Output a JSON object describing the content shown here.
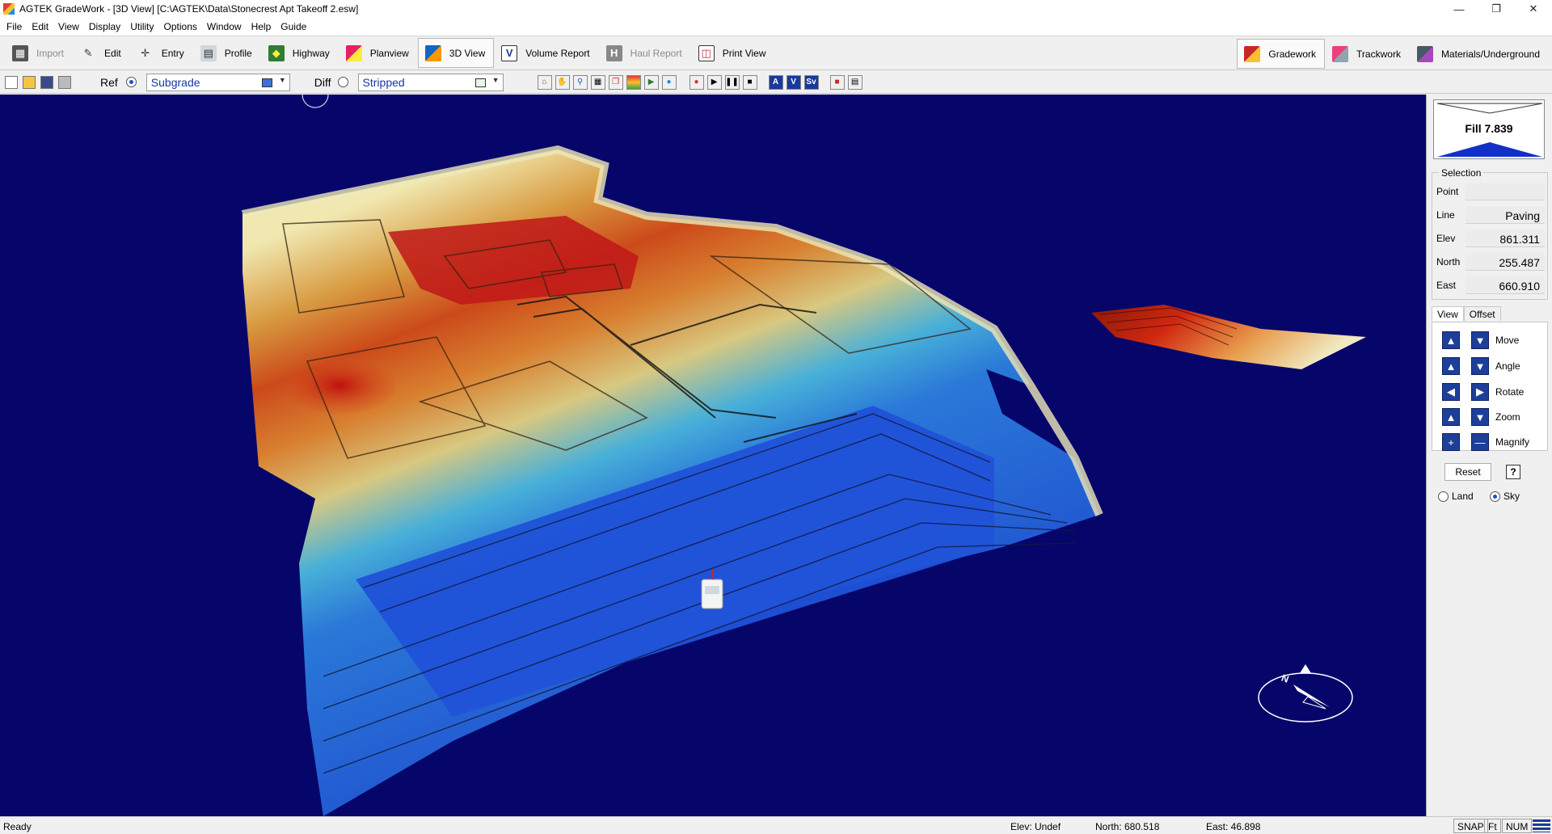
{
  "window": {
    "title": "AGTEK GradeWork - [3D View]  [C:\\AGTEK\\Data\\Stonecrest Apt Takeoff 2.esw]"
  },
  "menu": [
    "File",
    "Edit",
    "View",
    "Display",
    "Utility",
    "Options",
    "Window",
    "Help",
    "Guide"
  ],
  "main_toolbar": {
    "import": "Import",
    "edit": "Edit",
    "entry": "Entry",
    "profile": "Profile",
    "highway": "Highway",
    "planview": "Planview",
    "view3d": "3D View",
    "volume_report": "Volume Report",
    "haul_report": "Haul Report",
    "print_view": "Print View"
  },
  "modes": {
    "gradework": "Gradework",
    "trackwork": "Trackwork",
    "materials": "Materials/Underground"
  },
  "sub_toolbar": {
    "ref_label": "Ref",
    "ref_surface": "Subgrade",
    "ref_color": "#3f6fd8",
    "diff_label": "Diff",
    "diff_surface": "Stripped",
    "diff_color": "#e8f5e8"
  },
  "side_panel": {
    "fill_label": "Fill 7.839",
    "selection_title": "Selection",
    "fields": [
      {
        "key": "Point",
        "value": ""
      },
      {
        "key": "Line",
        "value": "Paving"
      },
      {
        "key": "Elev",
        "value": "861.311"
      },
      {
        "key": "North",
        "value": "255.487"
      },
      {
        "key": "East",
        "value": "660.910"
      }
    ],
    "tabs": [
      "View",
      "Offset"
    ],
    "controls": [
      "Move",
      "Angle",
      "Rotate",
      "Zoom",
      "Magnify"
    ],
    "reset": "Reset",
    "help": "?",
    "land": "Land",
    "sky": "Sky"
  },
  "status": {
    "ready": "Ready",
    "elev": "Elev: Undef",
    "north": "North: 680.518",
    "east": "East: 46.898",
    "snap": "SNAP",
    "ft": "Ft",
    "num": "NUM"
  }
}
